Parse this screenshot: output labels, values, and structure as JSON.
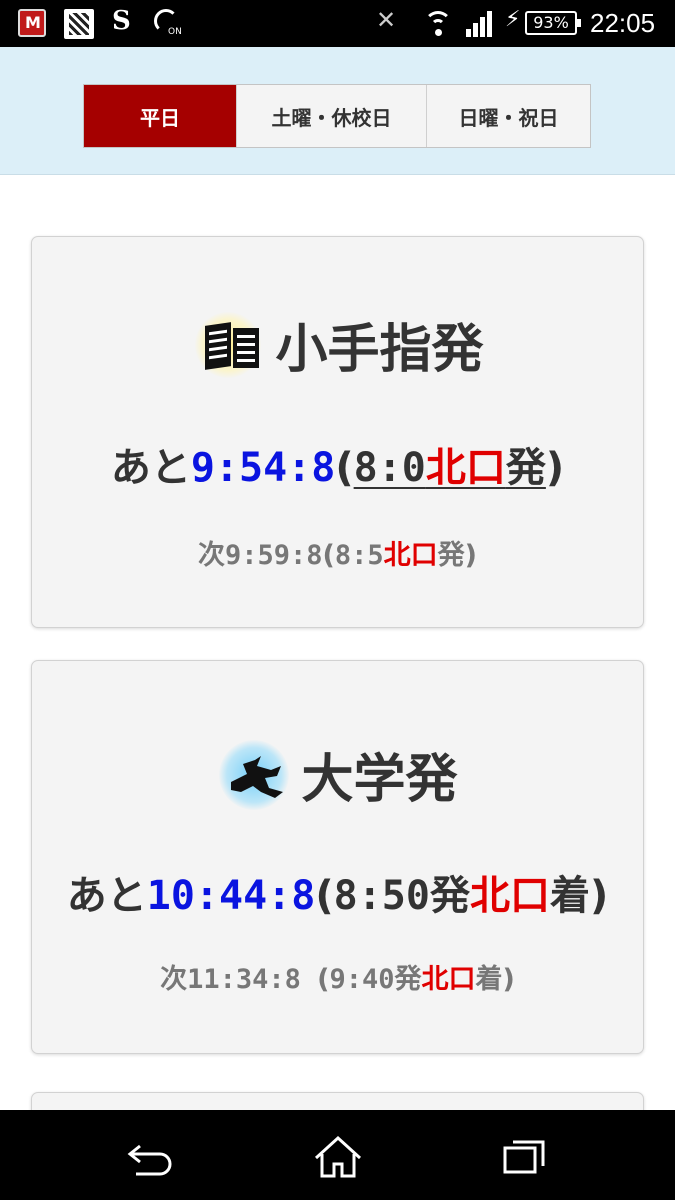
{
  "status_bar": {
    "icons": [
      "mcafee-icon",
      "app-icon",
      "s-app-icon",
      "nfc-icon",
      "vibrate-off-icon",
      "wifi-icon",
      "signal-icon",
      "charging-icon"
    ],
    "nfc_label": "ON",
    "battery": "93%",
    "time": "22:05"
  },
  "tabs": [
    {
      "label": "平日",
      "active": true
    },
    {
      "label": "土曜・休校日",
      "active": false
    },
    {
      "label": "日曜・祝日",
      "active": false
    }
  ],
  "cards": [
    {
      "title": "小手指発",
      "icon": "building-icon",
      "main": {
        "prefix": "あと",
        "countdown": "9:54:8",
        "open": "(",
        "time": "8:0",
        "place": "北口",
        "suffix": "発",
        "close": ")"
      },
      "next": {
        "prefix": "次",
        "countdown": "9:59:8",
        "open": "(",
        "time": "8:5",
        "place": "北口",
        "suffix": "発",
        "close": ")"
      }
    },
    {
      "title": "大学発",
      "icon": "runner-icon",
      "main": {
        "prefix": "あと",
        "countdown": "10:44:8",
        "open": "(",
        "time": "8:50発",
        "place": "北口",
        "suffix": "着",
        "close": ")"
      },
      "next": {
        "prefix": "次",
        "countdown": "11:34:8 ",
        "open": "(",
        "time": "9:40発",
        "place": "北口",
        "suffix": "着",
        "close": ")"
      }
    }
  ],
  "colors": {
    "active_tab": "#a50000",
    "countdown": "#0a14e0",
    "place": "#e00000",
    "header_bg": "#dceff8"
  },
  "nav_bar": [
    "back-icon",
    "home-icon",
    "recent-apps-icon"
  ]
}
